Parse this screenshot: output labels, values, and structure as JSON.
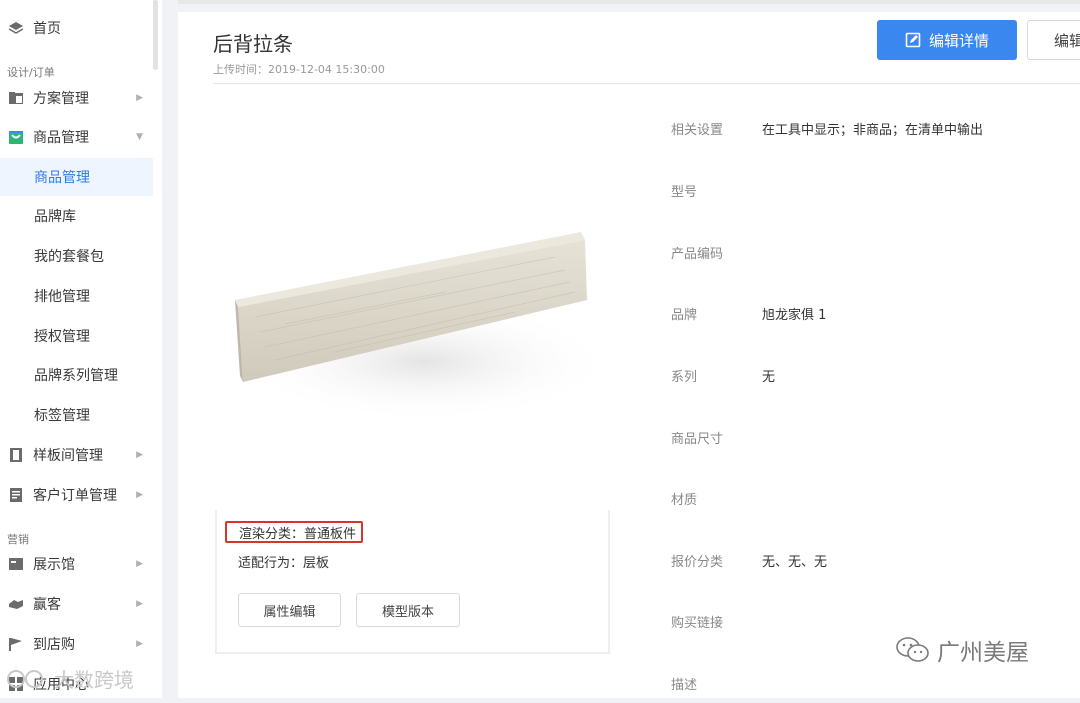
{
  "sidebar": {
    "home": "首页",
    "group_design": "设计/订单",
    "scheme": "方案管理",
    "goods": "商品管理",
    "sub_goods": "商品管理",
    "sub_brand_lib": "品牌库",
    "sub_package": "我的套餐包",
    "sub_other": "排他管理",
    "sub_auth": "授权管理",
    "sub_brand_series": "品牌系列管理",
    "sub_tags": "标签管理",
    "sample_room": "样板间管理",
    "customer_order": "客户订单管理",
    "group_marketing": "营销",
    "showroom": "展示馆",
    "winner": "赢客",
    "store": "到店购",
    "app_center": "应用中心"
  },
  "header": {
    "title": "后背拉条",
    "upload_time": "上传时间：2019-12-04 15:30:00",
    "edit_detail_label": "编辑详情",
    "edit_label": "编辑"
  },
  "card": {
    "render_category": "渲染分类：普通板件",
    "adapt_behavior": "适配行为：层板",
    "attr_edit_label": "属性编辑",
    "model_version_label": "模型版本"
  },
  "properties": [
    {
      "label": "相关设置",
      "value": "在工具中显示；非商品；在清单中输出"
    },
    {
      "label": "型号",
      "value": ""
    },
    {
      "label": "产品编码",
      "value": ""
    },
    {
      "label": "品牌",
      "value": "旭龙家俱 1"
    },
    {
      "label": "系列",
      "value": "无"
    },
    {
      "label": "商品尺寸",
      "value": ""
    },
    {
      "label": "材质",
      "value": ""
    },
    {
      "label": "报价分类",
      "value": "无、无、无"
    },
    {
      "label": "购买链接",
      "value": ""
    },
    {
      "label": "描述",
      "value": ""
    }
  ],
  "watermarks": {
    "right": "广州美屋",
    "left": "大数跨境"
  },
  "colors": {
    "accent": "#3b87f0",
    "highlight_border": "#d9342b",
    "active_bg": "#eef5ff"
  }
}
